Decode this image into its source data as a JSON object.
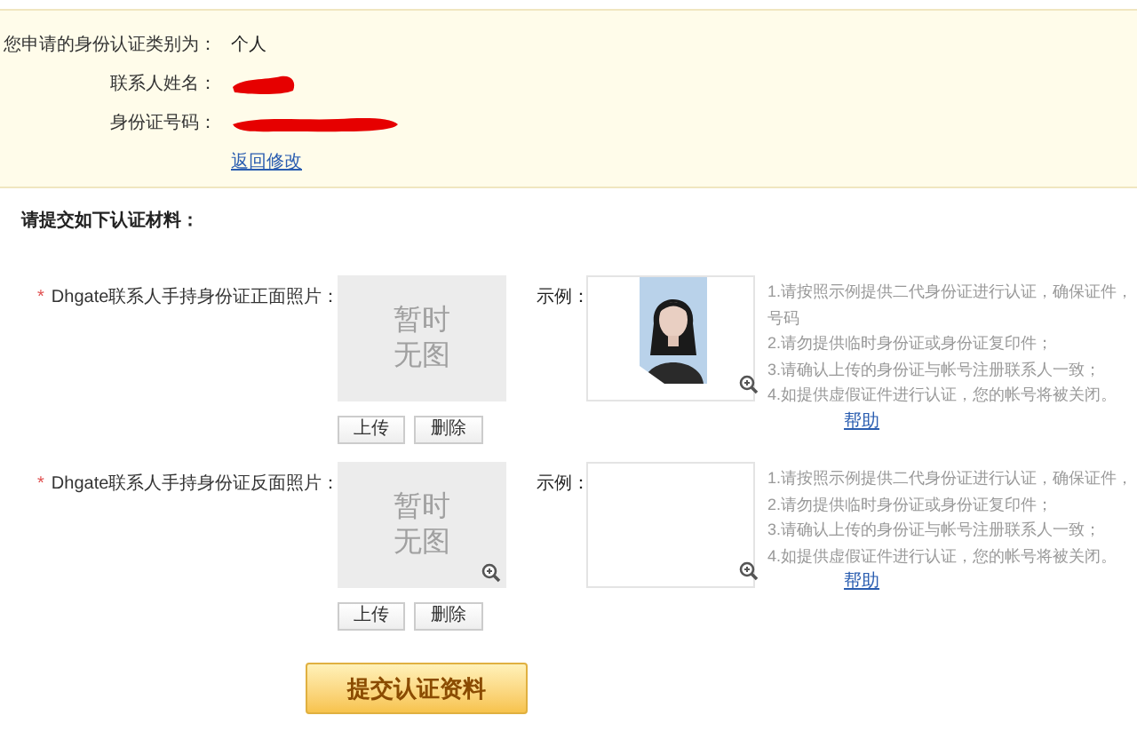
{
  "applicant_info": {
    "rows": [
      {
        "label": "您申请的身份认证类别为：",
        "value": "个人"
      },
      {
        "label": "联系人姓名：",
        "redacted": true
      },
      {
        "label": "身份证号码：",
        "redacted": true
      }
    ],
    "back_link": "返回修改"
  },
  "materials_heading": "请提交如下认证材料：",
  "sections": [
    {
      "required_mark": "*",
      "label": "Dhgate联系人手持身份证正面照片：",
      "placeholder": [
        "暂时",
        "无图"
      ],
      "upload_zoom": false,
      "upload_button": "上传",
      "delete_button": "删除",
      "example_label": "示例：",
      "example": {
        "kind": "picture"
      },
      "notes": [
        "1.请按照示例提供二代身份证进行认证，确保证件，",
        "号码",
        "2.请勿提供临时身份证或身份证复印件；",
        "3.请确认上传的身份证与帐号注册联系人一致；",
        "4.如提供虚假证件进行认证，您的帐号将被关闭。"
      ],
      "help_link": "帮助"
    },
    {
      "required_mark": "*",
      "label": "Dhgate联系人手持身份证反面照片：",
      "placeholder": [
        "暂时",
        "无图"
      ],
      "upload_zoom": true,
      "upload_button": "上传",
      "delete_button": "删除",
      "example_label": "示例：",
      "example": {
        "kind": "empty"
      },
      "notes": [
        "1.请按照示例提供二代身份证进行认证，确保证件，",
        "2.请勿提供临时身份证或身份证复印件；",
        "3.请确认上传的身份证与帐号注册联系人一致；",
        "4.如提供虚假证件进行认证，您的帐号将被关闭。"
      ],
      "help_link": "帮助"
    }
  ],
  "submit_button": "提交认证资料"
}
